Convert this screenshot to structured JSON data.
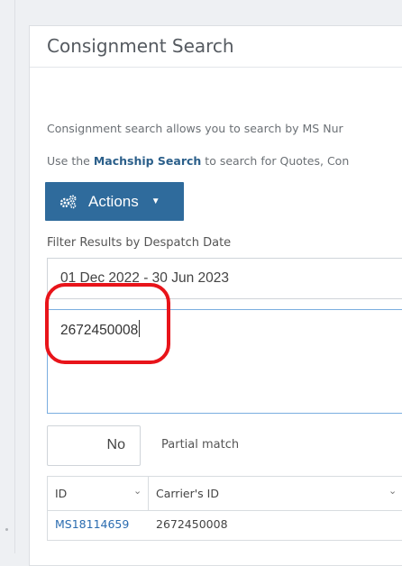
{
  "panel": {
    "title": "Consignment Search",
    "description_1": "Consignment search allows you to search by MS Nur",
    "description_2_prefix": "Use the ",
    "description_2_link": "Machship Search",
    "description_2_suffix": " to search for Quotes, Con"
  },
  "actions_button": {
    "label": "Actions",
    "icon": "cogs-icon",
    "caret_icon": "caret-down-icon"
  },
  "filter": {
    "label": "Filter Results by Despatch Date",
    "date_range": "01 Dec 2022 - 30 Jun 2023"
  },
  "search": {
    "value": "2672450008"
  },
  "partial_match": {
    "toggle_value": "No",
    "label": "Partial match"
  },
  "grid": {
    "columns": [
      "ID",
      "Carrier's ID"
    ],
    "rows": [
      {
        "id": "MS18114659",
        "carrier_id": "2672450008"
      }
    ]
  },
  "colors": {
    "primary_button": "#2f6b9c",
    "link": "#2b6cb0",
    "highlight_annotation": "#e8141a",
    "focus_border": "#7aaee0"
  }
}
